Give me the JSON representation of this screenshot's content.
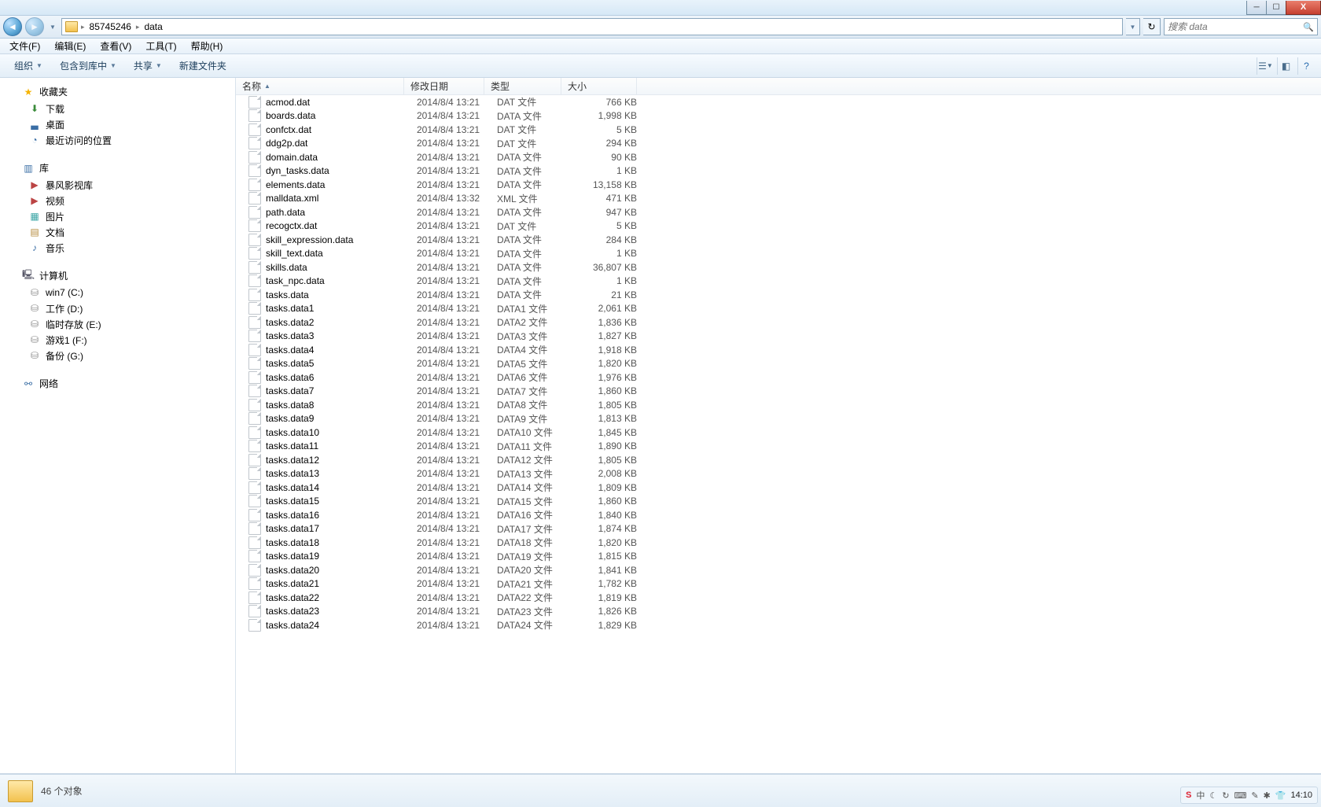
{
  "breadcrumb": {
    "seg1": "85745246",
    "seg2": "data"
  },
  "search": {
    "placeholder": "搜索 data"
  },
  "menu": {
    "file": "文件(F)",
    "edit": "编辑(E)",
    "view": "查看(V)",
    "tools": "工具(T)",
    "help": "帮助(H)"
  },
  "toolbar": {
    "organize": "组织",
    "include": "包含到库中",
    "share": "共享",
    "newfolder": "新建文件夹"
  },
  "columns": {
    "name": "名称",
    "date": "修改日期",
    "type": "类型",
    "size": "大小"
  },
  "sidebar": {
    "favorites": "收藏夹",
    "fav_items": [
      "下载",
      "桌面",
      "最近访问的位置"
    ],
    "libraries": "库",
    "lib_items": [
      "暴风影视库",
      "视频",
      "图片",
      "文档",
      "音乐"
    ],
    "computer": "计算机",
    "drives": [
      "win7 (C:)",
      "工作 (D:)",
      "临时存放 (E:)",
      "游戏1 (F:)",
      "备份 (G:)"
    ],
    "network": "网络"
  },
  "files": [
    {
      "n": "acmod.dat",
      "d": "2014/8/4 13:21",
      "t": "DAT 文件",
      "s": "766 KB"
    },
    {
      "n": "boards.data",
      "d": "2014/8/4 13:21",
      "t": "DATA 文件",
      "s": "1,998 KB"
    },
    {
      "n": "confctx.dat",
      "d": "2014/8/4 13:21",
      "t": "DAT 文件",
      "s": "5 KB"
    },
    {
      "n": "ddg2p.dat",
      "d": "2014/8/4 13:21",
      "t": "DAT 文件",
      "s": "294 KB"
    },
    {
      "n": "domain.data",
      "d": "2014/8/4 13:21",
      "t": "DATA 文件",
      "s": "90 KB"
    },
    {
      "n": "dyn_tasks.data",
      "d": "2014/8/4 13:21",
      "t": "DATA 文件",
      "s": "1 KB"
    },
    {
      "n": "elements.data",
      "d": "2014/8/4 13:21",
      "t": "DATA 文件",
      "s": "13,158 KB"
    },
    {
      "n": "malldata.xml",
      "d": "2014/8/4 13:32",
      "t": "XML 文件",
      "s": "471 KB"
    },
    {
      "n": "path.data",
      "d": "2014/8/4 13:21",
      "t": "DATA 文件",
      "s": "947 KB"
    },
    {
      "n": "recogctx.dat",
      "d": "2014/8/4 13:21",
      "t": "DAT 文件",
      "s": "5 KB"
    },
    {
      "n": "skill_expression.data",
      "d": "2014/8/4 13:21",
      "t": "DATA 文件",
      "s": "284 KB"
    },
    {
      "n": "skill_text.data",
      "d": "2014/8/4 13:21",
      "t": "DATA 文件",
      "s": "1 KB"
    },
    {
      "n": "skills.data",
      "d": "2014/8/4 13:21",
      "t": "DATA 文件",
      "s": "36,807 KB"
    },
    {
      "n": "task_npc.data",
      "d": "2014/8/4 13:21",
      "t": "DATA 文件",
      "s": "1 KB"
    },
    {
      "n": "tasks.data",
      "d": "2014/8/4 13:21",
      "t": "DATA 文件",
      "s": "21 KB"
    },
    {
      "n": "tasks.data1",
      "d": "2014/8/4 13:21",
      "t": "DATA1 文件",
      "s": "2,061 KB"
    },
    {
      "n": "tasks.data2",
      "d": "2014/8/4 13:21",
      "t": "DATA2 文件",
      "s": "1,836 KB"
    },
    {
      "n": "tasks.data3",
      "d": "2014/8/4 13:21",
      "t": "DATA3 文件",
      "s": "1,827 KB"
    },
    {
      "n": "tasks.data4",
      "d": "2014/8/4 13:21",
      "t": "DATA4 文件",
      "s": "1,918 KB"
    },
    {
      "n": "tasks.data5",
      "d": "2014/8/4 13:21",
      "t": "DATA5 文件",
      "s": "1,820 KB"
    },
    {
      "n": "tasks.data6",
      "d": "2014/8/4 13:21",
      "t": "DATA6 文件",
      "s": "1,976 KB"
    },
    {
      "n": "tasks.data7",
      "d": "2014/8/4 13:21",
      "t": "DATA7 文件",
      "s": "1,860 KB"
    },
    {
      "n": "tasks.data8",
      "d": "2014/8/4 13:21",
      "t": "DATA8 文件",
      "s": "1,805 KB"
    },
    {
      "n": "tasks.data9",
      "d": "2014/8/4 13:21",
      "t": "DATA9 文件",
      "s": "1,813 KB"
    },
    {
      "n": "tasks.data10",
      "d": "2014/8/4 13:21",
      "t": "DATA10 文件",
      "s": "1,845 KB"
    },
    {
      "n": "tasks.data11",
      "d": "2014/8/4 13:21",
      "t": "DATA11 文件",
      "s": "1,890 KB"
    },
    {
      "n": "tasks.data12",
      "d": "2014/8/4 13:21",
      "t": "DATA12 文件",
      "s": "1,805 KB"
    },
    {
      "n": "tasks.data13",
      "d": "2014/8/4 13:21",
      "t": "DATA13 文件",
      "s": "2,008 KB"
    },
    {
      "n": "tasks.data14",
      "d": "2014/8/4 13:21",
      "t": "DATA14 文件",
      "s": "1,809 KB"
    },
    {
      "n": "tasks.data15",
      "d": "2014/8/4 13:21",
      "t": "DATA15 文件",
      "s": "1,860 KB"
    },
    {
      "n": "tasks.data16",
      "d": "2014/8/4 13:21",
      "t": "DATA16 文件",
      "s": "1,840 KB"
    },
    {
      "n": "tasks.data17",
      "d": "2014/8/4 13:21",
      "t": "DATA17 文件",
      "s": "1,874 KB"
    },
    {
      "n": "tasks.data18",
      "d": "2014/8/4 13:21",
      "t": "DATA18 文件",
      "s": "1,820 KB"
    },
    {
      "n": "tasks.data19",
      "d": "2014/8/4 13:21",
      "t": "DATA19 文件",
      "s": "1,815 KB"
    },
    {
      "n": "tasks.data20",
      "d": "2014/8/4 13:21",
      "t": "DATA20 文件",
      "s": "1,841 KB"
    },
    {
      "n": "tasks.data21",
      "d": "2014/8/4 13:21",
      "t": "DATA21 文件",
      "s": "1,782 KB"
    },
    {
      "n": "tasks.data22",
      "d": "2014/8/4 13:21",
      "t": "DATA22 文件",
      "s": "1,819 KB"
    },
    {
      "n": "tasks.data23",
      "d": "2014/8/4 13:21",
      "t": "DATA23 文件",
      "s": "1,826 KB"
    },
    {
      "n": "tasks.data24",
      "d": "2014/8/4 13:21",
      "t": "DATA24 文件",
      "s": "1,829 KB"
    }
  ],
  "status": {
    "text": "46 个对象"
  },
  "tray": {
    "ime": "中",
    "clock": "14:10"
  }
}
